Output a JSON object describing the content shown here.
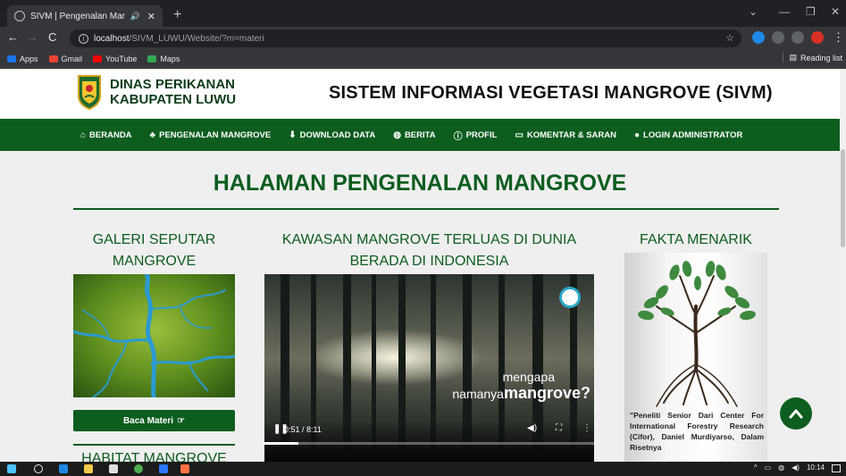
{
  "browser": {
    "tab_title": "SIVM | Pengenalan Mangrove",
    "url_host": "localhost",
    "url_path": "/SIVM_LUWU/Website/?m=materi",
    "bookmarks": [
      "Apps",
      "Gmail",
      "YouTube",
      "Maps"
    ],
    "reading_list": "Reading list"
  },
  "site": {
    "agency_line1": "DINAS PERIKANAN",
    "agency_line2": "KABUPATEN LUWU",
    "title": "SISTEM INFORMASI VEGETASI MANGROVE (SIVM)"
  },
  "nav": {
    "items": [
      {
        "label": "BERANDA",
        "icon": "home-icon"
      },
      {
        "label": "PENGENALAN MANGROVE",
        "icon": "tree-icon"
      },
      {
        "label": "DOWNLOAD DATA",
        "icon": "download-icon"
      },
      {
        "label": "BERITA",
        "icon": "globe-icon"
      },
      {
        "label": "PROFIL",
        "icon": "info-icon"
      },
      {
        "label": "KOMENTAR & SARAN",
        "icon": "laptop-icon"
      },
      {
        "label": "LOGIN ADMINISTRATOR",
        "icon": "user-icon"
      }
    ]
  },
  "main": {
    "heading": "HALAMAN PENGENALAN MANGROVE",
    "gallery_title": "GALERI SEPUTAR MANGROVE",
    "read_button": "Baca Materi",
    "habitat_title": "HABITAT MANGROVE",
    "video_title": "KAWASAN MANGROVE TERLUAS DI DUNIA BERADA DI INDONESIA",
    "video_caption_line1": "mengapa",
    "video_caption_line2a": "namanya",
    "video_caption_line2b": "mangrove?",
    "video_time": "0:51 / 8:11",
    "video_progress": 0.104,
    "fact_title": "FAKTA MENARIK",
    "fact_text": "\"Peneliti Senior Dari Center For International Forestry Research (Cifor), Daniel Murdiyarso, Dalam Risetnya"
  },
  "taskbar": {
    "time": "10:14"
  },
  "colors": {
    "brand_green": "#0d5d1f",
    "page_bg": "#efefef"
  }
}
